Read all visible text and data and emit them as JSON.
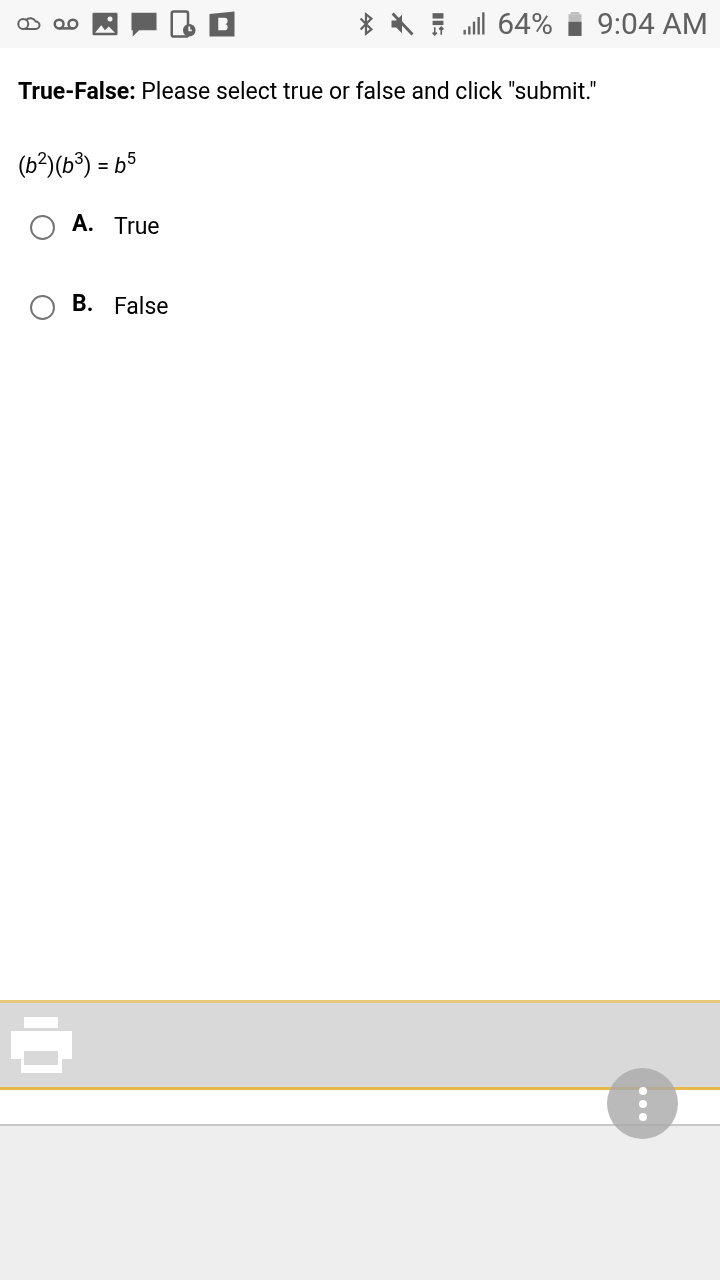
{
  "status_bar": {
    "battery": "64%",
    "time": "9:04 AM"
  },
  "question": {
    "label": "True-False:",
    "instruction": "Please select true or false and click \"submit.\"",
    "expression": "(*b*$^{2}$)(*b*$^{3}$) = *b*$^{5}$"
  },
  "options": [
    {
      "letter": "A.",
      "text": "True",
      "selected": false
    },
    {
      "letter": "B.",
      "text": "False",
      "selected": false
    }
  ]
}
